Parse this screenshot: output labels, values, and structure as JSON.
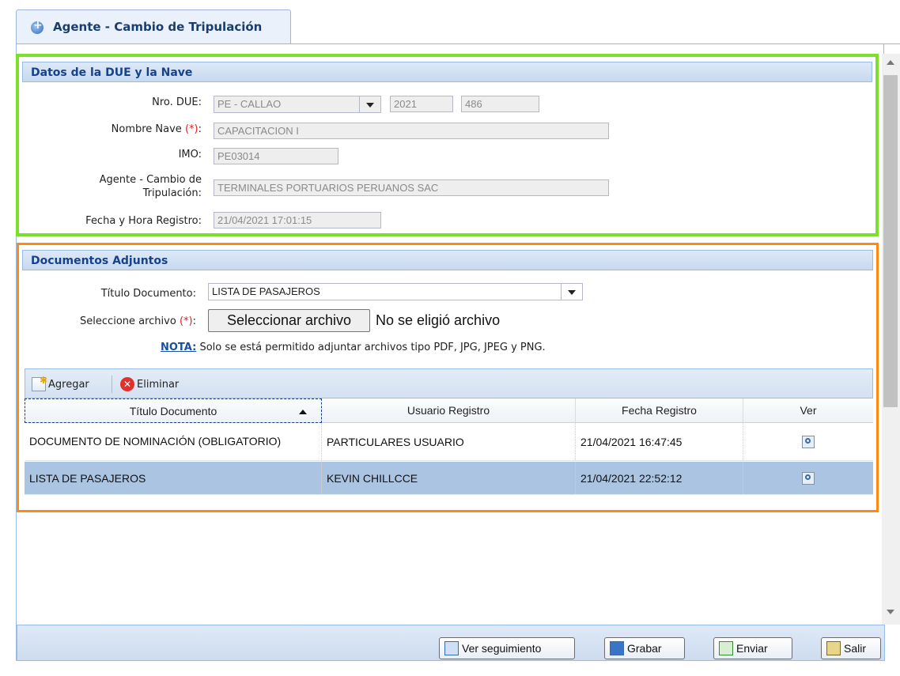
{
  "tab": {
    "title": "Agente - Cambio de Tripulación"
  },
  "section1": {
    "title": "Datos de la DUE y la Nave",
    "nro_due_label": "Nro. DUE:",
    "nro_due_port": "PE - CALLAO",
    "nro_due_year": "2021",
    "nro_due_number": "486",
    "nombre_nave_label": "Nombre Nave",
    "required_mark": "(*)",
    "colon": ":",
    "nombre_nave_value": "CAPACITACION I",
    "imo_label": "IMO:",
    "imo_value": "PE03014",
    "agente_label_line1": "Agente - Cambio de",
    "agente_label_line2": "Tripulación:",
    "agente_value": "TERMINALES PORTUARIOS PERUANOS SAC",
    "fecha_label": "Fecha y Hora Registro:",
    "fecha_value": "21/04/2021 17:01:15"
  },
  "section2": {
    "title": "Documentos Adjuntos",
    "titulo_label": "Título Documento:",
    "titulo_value": "LISTA DE PASAJEROS",
    "archivo_label": "Seleccione archivo",
    "file_button": "Seleccionar archivo",
    "file_status": "No se eligió archivo",
    "nota_label": "NOTA:",
    "nota_text": "Solo se está permitido adjuntar archivos tipo PDF, JPG, JPEG y PNG."
  },
  "grid": {
    "toolbar": {
      "add": "Agregar",
      "remove": "Eliminar"
    },
    "columns": [
      "Título Documento",
      "Usuario Registro",
      "Fecha Registro",
      "Ver"
    ],
    "rows": [
      {
        "titulo": "DOCUMENTO DE NOMINACIÓN (OBLIGATORIO)",
        "usuario": "PARTICULARES USUARIO",
        "fecha": "21/04/2021 16:47:45",
        "icon": "magnifier-icon"
      },
      {
        "titulo": "LISTA DE PASAJEROS",
        "usuario": "KEVIN CHILLCCE",
        "fecha": "21/04/2021 22:52:12",
        "icon": "magnifier-icon"
      }
    ]
  },
  "footer": {
    "ver_seguimiento": "Ver seguimiento",
    "grabar": "Grabar",
    "enviar": "Enviar",
    "salir": "Salir"
  },
  "colors": {
    "green_highlight": "#7ae02b",
    "orange_highlight": "#ff8a12",
    "selected_row": "#aac4e2",
    "section_title": "#15428b"
  }
}
